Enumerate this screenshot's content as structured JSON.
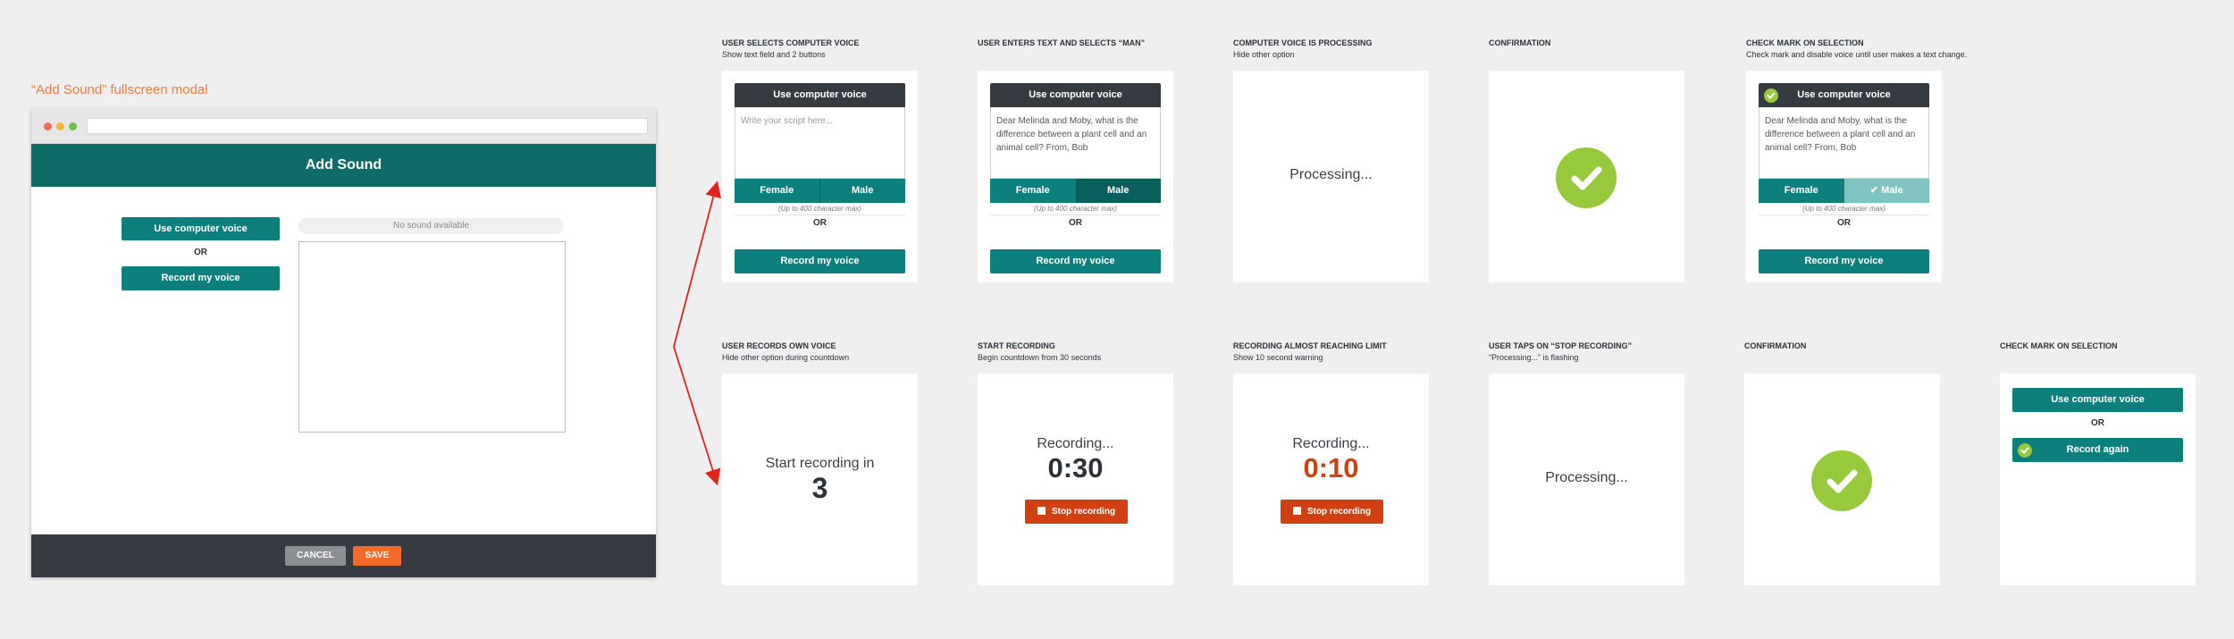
{
  "modal": {
    "caption": "“Add Sound” fullscreen modal",
    "header_title": "Add Sound",
    "computer_voice_button": "Use computer voice",
    "or_label": "OR",
    "record_button": "Record my voice",
    "no_sound_label": "No sound available",
    "cancel_button": "CANCEL",
    "save_button": "SAVE",
    "dot_colors": [
      "#ee6b55",
      "#f5b73a",
      "#6cc24a"
    ]
  },
  "colors": {
    "teal": "#0d7f7c",
    "teal_dark": "#0a5f5c",
    "dark": "#363b42",
    "orange": "#f26b2b",
    "red": "#d04012",
    "check_green": "#97c93d",
    "disabled_teal": "#7fc4c1"
  },
  "row1": [
    {
      "title": "USER SELECTS COMPUTER VOICE",
      "subtitle": "Show text field and 2 buttons",
      "header": "Use computer voice",
      "script_placeholder": "Write your script here...",
      "female": "Female",
      "male": "Male",
      "hint": "(Up to 400 character max)",
      "or": "OR",
      "record": "Record my voice"
    },
    {
      "title": "USER ENTERS TEXT AND SELECTS “MAN”",
      "subtitle": "",
      "header": "Use computer voice",
      "script_text": "Dear Melinda and Moby, what is the difference between a plant cell and an animal cell? From, Bob",
      "female": "Female",
      "male": "Male",
      "hint": "(Up to 400 character max)",
      "or": "OR",
      "record": "Record my voice"
    },
    {
      "title": "COMPUTER VOICE IS PROCESSING",
      "subtitle": "Hide other option",
      "processing": "Processing..."
    },
    {
      "title": "CONFIRMATION",
      "subtitle": ""
    },
    {
      "title": "CHECK MARK ON SELECTION",
      "subtitle": "Check mark and disable voice until user makes a text change.",
      "header": "Use computer voice",
      "script_text": "Dear Melinda and Moby, what is the difference between a plant cell and an animal cell? From, Bob",
      "female": "Female",
      "male": "Male",
      "hint": "(Up to 400 character max)",
      "or": "OR",
      "record": "Record my voice"
    }
  ],
  "row2": [
    {
      "title": "USER RECORDS OWN VOICE",
      "subtitle": "Hide other option during countdown",
      "countdown_label": "Start recording in",
      "countdown_value": "3"
    },
    {
      "title": "START RECORDING",
      "subtitle": "Begin countdown from 30 seconds",
      "status": "Recording...",
      "timer": "0:30",
      "stop": "Stop recording"
    },
    {
      "title": "RECORDING ALMOST REACHING LIMIT",
      "subtitle": "Show 10 second warning",
      "status": "Recording...",
      "timer": "0:10",
      "stop": "Stop recording"
    },
    {
      "title": "USER TAPS ON “STOP RECORDING”",
      "subtitle": "“Processing...” is flashing",
      "processing": "Processing..."
    },
    {
      "title": "CONFIRMATION",
      "subtitle": ""
    },
    {
      "title": "CHECK MARK ON SELECTION",
      "subtitle": "",
      "computer_voice": "Use computer voice",
      "or": "OR",
      "record_again": "Record again"
    }
  ]
}
